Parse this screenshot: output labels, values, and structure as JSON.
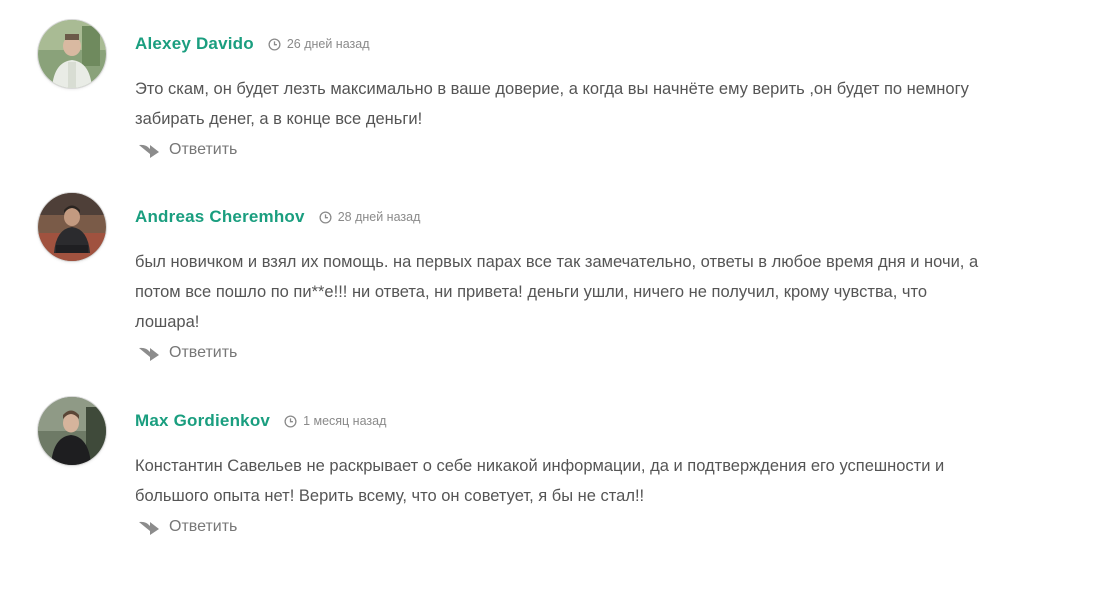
{
  "comments": [
    {
      "author": "Alexey Davido",
      "time": "26 дней назад",
      "text": "Это скам, он будет лезть максимально в ваше доверие, а когда вы начнёте ему верить ,он будет по немногу забирать денег, а в конце все деньги!",
      "reply_label": "Ответить"
    },
    {
      "author": "Andreas Cheremhov",
      "time": "28 дней назад",
      "text": "был новичком и взял их помощь. на первых парах все так замечательно, ответы в любое время дня и ночи, а потом все пошло по пи**е!!! ни ответа, ни привета! деньги ушли, ничего не получил, крому чувства, что лошара!",
      "reply_label": "Ответить"
    },
    {
      "author": "Max Gordienkov",
      "time": "1 месяц назад",
      "text": "Константин Савельев не раскрывает о себе никакой информации, да и подтверждения его успешности и большого опыта нет! Верить всему, что он советует, я бы не стал!!",
      "reply_label": "Ответить"
    }
  ],
  "colors": {
    "author": "#1a9e7f",
    "text": "#555555",
    "meta": "#8a8a8a",
    "reply_icon": "#8c8c8c"
  },
  "icons": {
    "time": "clock-icon",
    "reply": "reply-arrow-icon",
    "avatar": "user-photo"
  }
}
